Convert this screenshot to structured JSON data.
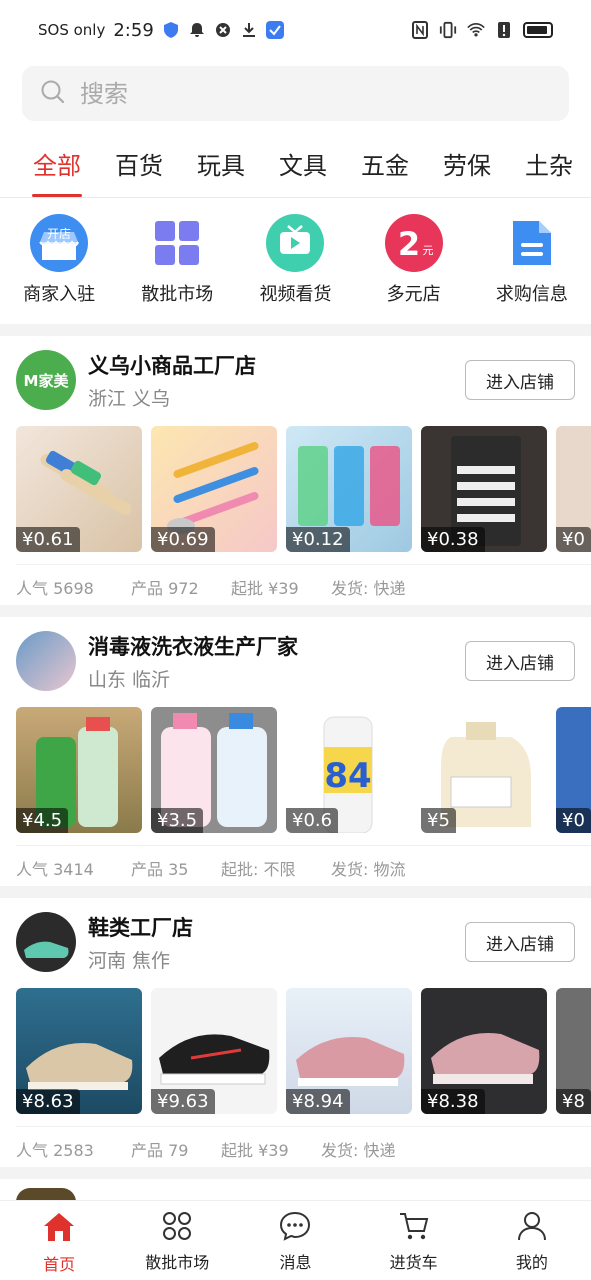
{
  "status": {
    "carrier": "SOS only",
    "time": "2:59"
  },
  "search": {
    "placeholder": "搜索"
  },
  "tabs": [
    {
      "label": "全部",
      "active": true
    },
    {
      "label": "百货"
    },
    {
      "label": "玩具"
    },
    {
      "label": "文具"
    },
    {
      "label": "五金"
    },
    {
      "label": "劳保"
    },
    {
      "label": "土杂"
    }
  ],
  "categories": [
    {
      "label": "商家入驻",
      "icon": "shop-open-icon",
      "badge": "开店",
      "color": "#3d8ef0"
    },
    {
      "label": "散批市场",
      "icon": "grid-icon",
      "color": "#7b7cf0"
    },
    {
      "label": "视频看货",
      "icon": "tv-icon",
      "color": "#3fcfae"
    },
    {
      "label": "多元店",
      "icon": "two-yuan-icon",
      "badge": "2",
      "badge_small": "元",
      "color": "#e8365a"
    },
    {
      "label": "求购信息",
      "icon": "document-icon",
      "color": "#3d8ef0"
    }
  ],
  "shops": [
    {
      "name": "义乌小商品工厂店",
      "location": "浙江 义乌",
      "avatar_text": "M家美",
      "enter_label": "进入店铺",
      "products": [
        {
          "price": "¥0.61"
        },
        {
          "price": "¥0.69"
        },
        {
          "price": "¥0.12"
        },
        {
          "price": "¥0.38"
        },
        {
          "price": "¥0"
        }
      ],
      "stats": {
        "popularity": "人气 5698",
        "products": "产品 972",
        "min_order": "起批 ¥39",
        "shipping": "发货: 快递"
      }
    },
    {
      "name": "消毒液洗衣液生产厂家",
      "location": "山东 临沂",
      "enter_label": "进入店铺",
      "products": [
        {
          "price": "¥4.5"
        },
        {
          "price": "¥3.5"
        },
        {
          "price": "¥0.6"
        },
        {
          "price": "¥5"
        },
        {
          "price": "¥0"
        }
      ],
      "stats": {
        "popularity": "人气 3414",
        "products": "产品 35",
        "min_order": "起批: 不限",
        "shipping": "发货: 物流"
      }
    },
    {
      "name": "鞋类工厂店",
      "location": "河南 焦作",
      "enter_label": "进入店铺",
      "products": [
        {
          "price": "¥8.63"
        },
        {
          "price": "¥9.63"
        },
        {
          "price": "¥8.94"
        },
        {
          "price": "¥8.38"
        },
        {
          "price": "¥8"
        }
      ],
      "stats": {
        "popularity": "人气 2583",
        "products": "产品 79",
        "min_order": "起批 ¥39",
        "shipping": "发货: 快递"
      }
    }
  ],
  "bottom_nav": [
    {
      "label": "首页",
      "icon": "home-icon",
      "active": true
    },
    {
      "label": "散批市场",
      "icon": "grid-icon"
    },
    {
      "label": "消息",
      "icon": "message-icon"
    },
    {
      "label": "进货车",
      "icon": "cart-icon"
    },
    {
      "label": "我的",
      "icon": "profile-icon"
    }
  ],
  "colors": {
    "accent": "#e0322d"
  }
}
